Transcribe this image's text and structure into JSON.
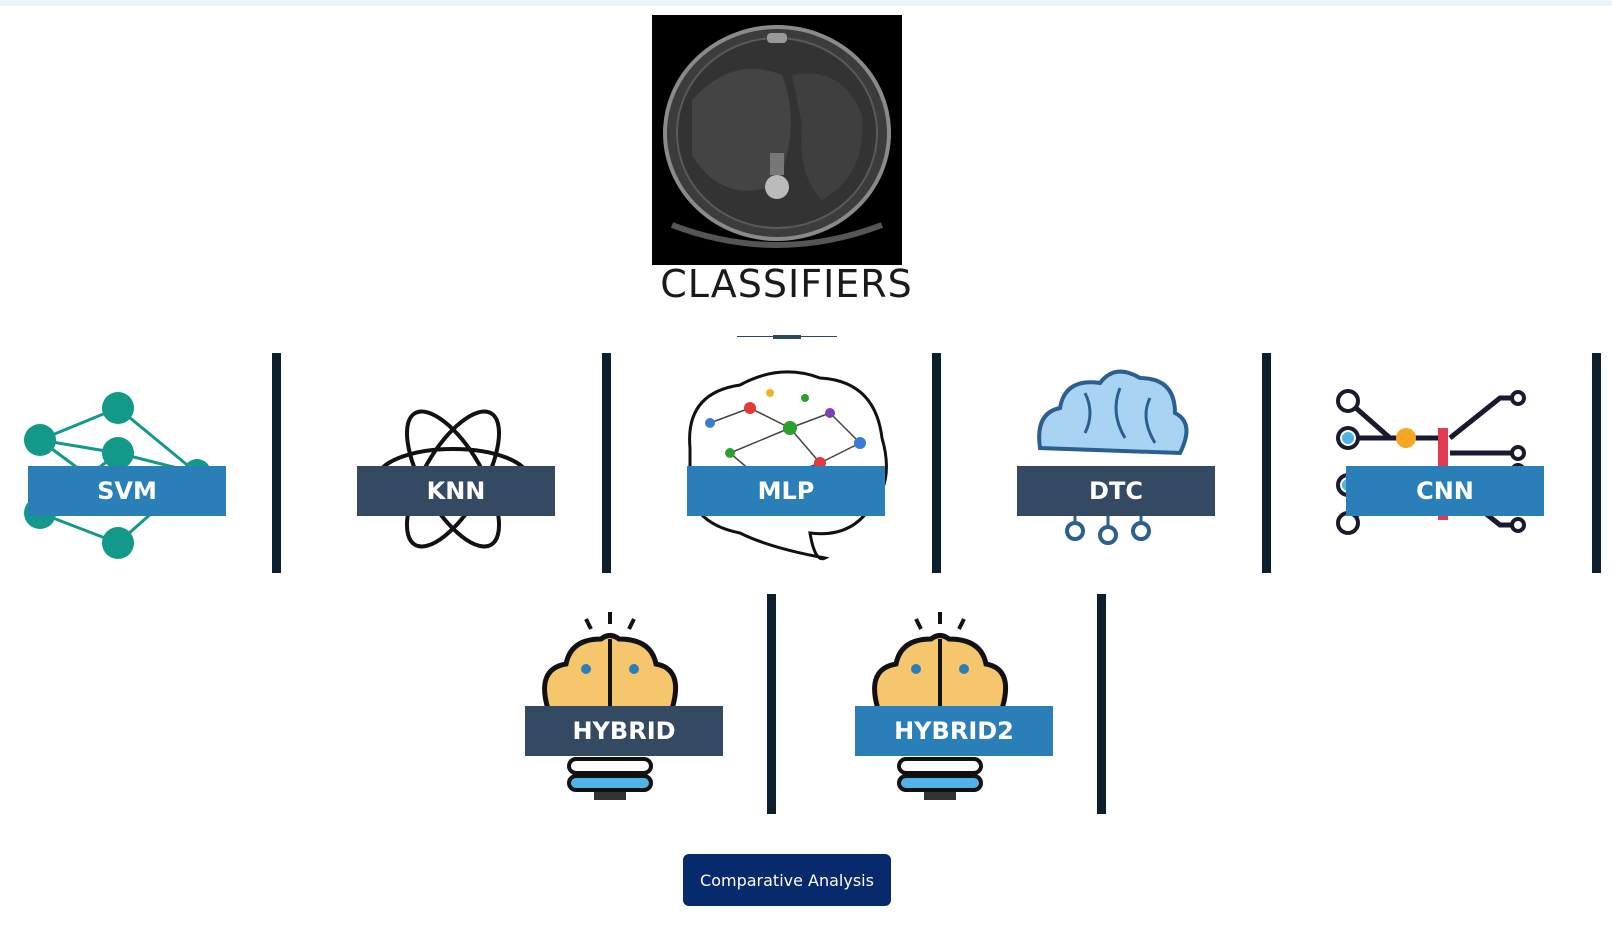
{
  "header": {
    "title": "CLASSIFIERS"
  },
  "classifiers_row1": [
    {
      "label": "SVM",
      "icon": "neural-network-icon",
      "style": "blue"
    },
    {
      "label": "KNN",
      "icon": "atom-icon",
      "style": "slate"
    },
    {
      "label": "MLP",
      "icon": "brain-network-icon",
      "style": "blue"
    },
    {
      "label": "DTC",
      "icon": "brain-circuit-icon",
      "style": "slate"
    },
    {
      "label": "CNN",
      "icon": "circuit-chip-icon",
      "style": "blue"
    }
  ],
  "classifiers_row2": [
    {
      "label": "HYBRID",
      "icon": "brain-bulb-icon",
      "style": "slate"
    },
    {
      "label": "HYBRID2",
      "icon": "brain-bulb-icon",
      "style": "blue"
    }
  ],
  "actions": {
    "comparative_label": "Comparative Analysis"
  },
  "colors": {
    "blue": "#2b7fb8",
    "slate": "#344a62",
    "separator": "#0c1f2e",
    "button": "#062a6b"
  }
}
